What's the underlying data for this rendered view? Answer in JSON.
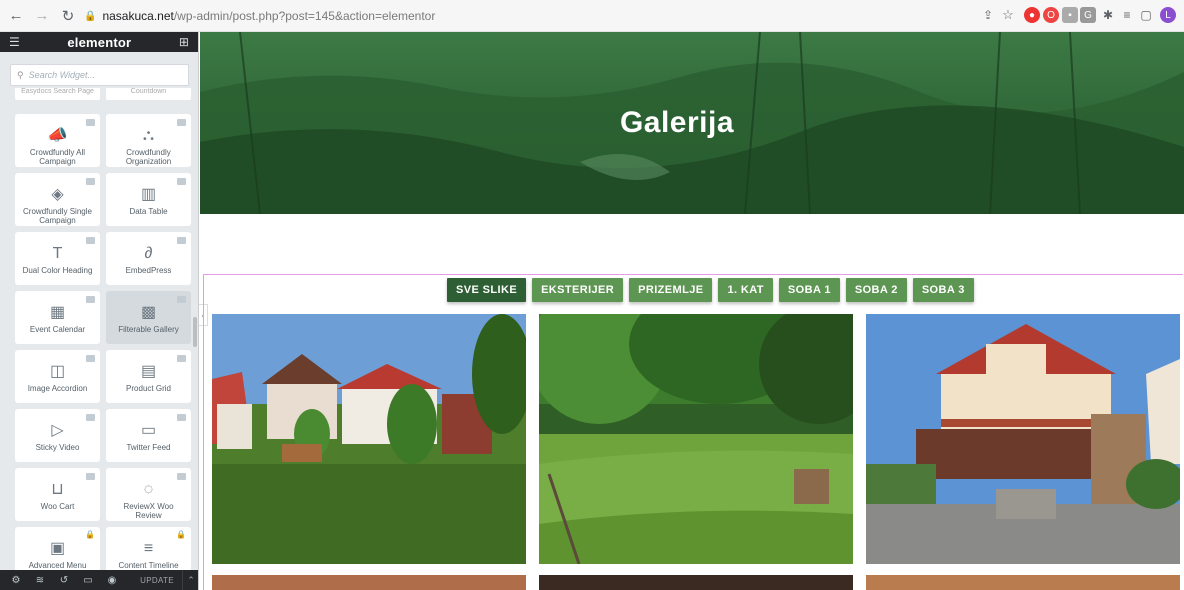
{
  "browser": {
    "url_domain": "nasakuca.net",
    "url_path": "/wp-admin/post.php?post=145&action=elementor",
    "profile_initial": "L"
  },
  "panel": {
    "logo": "elementor",
    "search_placeholder": "Search Widget...",
    "cut_labels": [
      "Easydocs Search Page",
      "Countdown"
    ],
    "widgets": [
      {
        "label": "Crowdfundly All Campaign",
        "icon": "megaphone-icon",
        "glyph": "📣"
      },
      {
        "label": "Crowdfundly Organization",
        "icon": "organization-icon",
        "glyph": "⛬"
      },
      {
        "label": "Crowdfundly Single Campaign",
        "icon": "single-campaign-icon",
        "glyph": "◈"
      },
      {
        "label": "Data Table",
        "icon": "table-icon",
        "glyph": "▥"
      },
      {
        "label": "Dual Color Heading",
        "icon": "dual-heading-icon",
        "glyph": "T"
      },
      {
        "label": "EmbedPress",
        "icon": "embed-icon",
        "glyph": "∂"
      },
      {
        "label": "Event Calendar",
        "icon": "calendar-icon",
        "glyph": "▦"
      },
      {
        "label": "Filterable Gallery",
        "icon": "gallery-icon",
        "glyph": "▩"
      },
      {
        "label": "Image Accordion",
        "icon": "accordion-icon",
        "glyph": "◫"
      },
      {
        "label": "Product Grid",
        "icon": "product-grid-icon",
        "glyph": "▤"
      },
      {
        "label": "Sticky Video",
        "icon": "video-icon",
        "glyph": "▷"
      },
      {
        "label": "Twitter Feed",
        "icon": "twitter-feed-icon",
        "glyph": "▭"
      },
      {
        "label": "Woo Cart",
        "icon": "cart-icon",
        "glyph": "⊔"
      },
      {
        "label": "ReviewX Woo Review",
        "icon": "review-icon",
        "glyph": "◌"
      },
      {
        "label": "Advanced Menu",
        "icon": "menu-icon",
        "glyph": "▣"
      },
      {
        "label": "Content Timeline",
        "icon": "timeline-icon",
        "glyph": "≡"
      }
    ],
    "update_label": "UPDATE"
  },
  "page": {
    "hero_title": "Galerija",
    "filters": [
      "SVE SLIKE",
      "EKSTERIJER",
      "PRIZEMLJE",
      "1. KAT",
      "SOBA 1",
      "SOBA 2",
      "SOBA 3"
    ]
  },
  "colors": {
    "accent_green": "#5d9552",
    "active_green": "#2e5e33",
    "panel_dark": "#26272a",
    "section_border": "#e59be6"
  }
}
